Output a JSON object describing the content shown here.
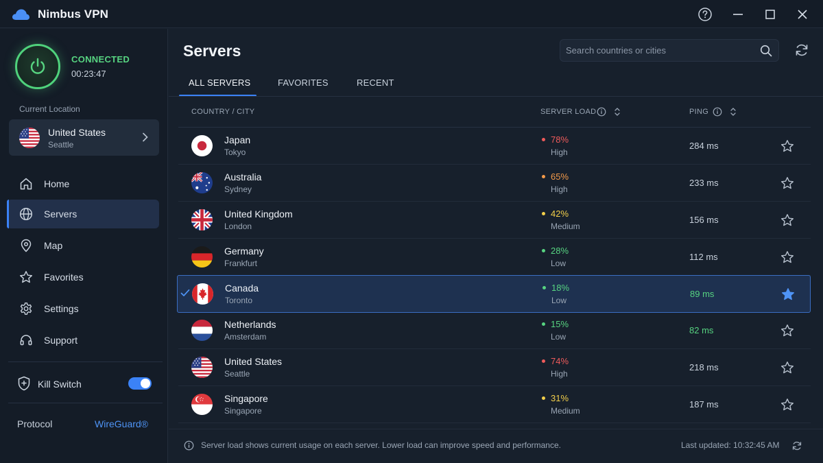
{
  "app": {
    "title": "Nimbus VPN"
  },
  "connection": {
    "status": "CONNECTED",
    "duration": "00:23:47"
  },
  "current_location": {
    "label": "Current Location",
    "country": "United States",
    "city": "Seattle"
  },
  "sidebar": {
    "items": [
      {
        "label": "Home",
        "icon": "home-icon"
      },
      {
        "label": "Servers",
        "icon": "globe-icon",
        "active": true
      },
      {
        "label": "Map",
        "icon": "map-pin-icon"
      },
      {
        "label": "Favorites",
        "icon": "star-icon"
      },
      {
        "label": "Settings",
        "icon": "gear-icon"
      },
      {
        "label": "Support",
        "icon": "headset-icon"
      }
    ],
    "kill_switch": {
      "label": "Kill Switch",
      "enabled": true
    },
    "protocol": {
      "label": "Protocol",
      "value": "WireGuard®"
    }
  },
  "main": {
    "title": "Servers",
    "search": {
      "placeholder": "Search countries or cities",
      "value": ""
    },
    "tabs": [
      "ALL SERVERS",
      "FAVORITES",
      "RECENT"
    ],
    "columns": {
      "country": "COUNTRY / CITY",
      "load": "SERVER LOAD",
      "ping": "PING"
    },
    "rows": [
      {
        "country": "Japan",
        "city": "Tokyo",
        "load": "78%",
        "level": "High",
        "ping": "284 ms",
        "favorite": false,
        "selected": false
      },
      {
        "country": "Australia",
        "city": "Sydney",
        "load": "65%",
        "level": "High",
        "ping": "233 ms",
        "favorite": false,
        "selected": false
      },
      {
        "country": "United Kingdom",
        "city": "London",
        "load": "42%",
        "level": "Medium",
        "ping": "156 ms",
        "favorite": false,
        "selected": false
      },
      {
        "country": "Germany",
        "city": "Frankfurt",
        "load": "28%",
        "level": "Low",
        "ping": "112 ms",
        "favorite": false,
        "selected": false
      },
      {
        "country": "Canada",
        "city": "Toronto",
        "load": "18%",
        "level": "Low",
        "ping": "89 ms",
        "favorite": true,
        "selected": true
      },
      {
        "country": "Netherlands",
        "city": "Amsterdam",
        "load": "15%",
        "level": "Low",
        "ping": "82 ms",
        "favorite": false,
        "selected": false
      },
      {
        "country": "United States",
        "city": "Seattle",
        "load": "74%",
        "level": "High",
        "ping": "218 ms",
        "favorite": false,
        "selected": false
      },
      {
        "country": "Singapore",
        "city": "Singapore",
        "load": "31%",
        "level": "Medium",
        "ping": "187 ms",
        "favorite": false,
        "selected": false
      }
    ],
    "footer": {
      "note": "Server load shows current usage on each server. Lower load can improve speed and performance.",
      "last_updated": "Last updated: 10:32:45 AM"
    }
  },
  "colors": {
    "accent": "#3b82f6",
    "connected": "#57d481",
    "load_high": "#ef5b5b",
    "load_orange": "#f39a4a",
    "load_medium": "#f3cf4a",
    "load_low": "#57d481"
  }
}
